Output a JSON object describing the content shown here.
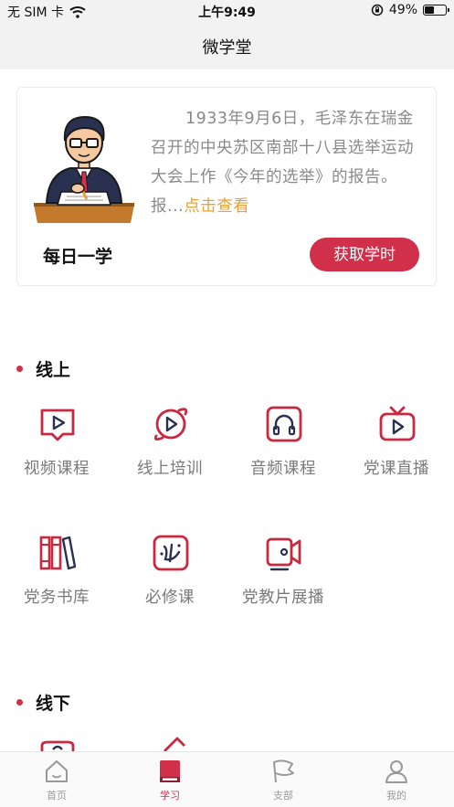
{
  "status_bar": {
    "carrier": "无 SIM 卡",
    "time": "上午9:49",
    "battery_percent": "49%",
    "battery_level": 0.49,
    "icons": [
      "wifi-icon",
      "orientation-lock-icon",
      "battery-icon"
    ]
  },
  "nav": {
    "title": "微学堂"
  },
  "daily_card": {
    "excerpt": "1933年9月6日，毛泽东在瑞金召开的中央苏区南部十八县选举运动大会上作《今年的选举》的报告。报...",
    "more_link": "点击查看",
    "label": "每日一学",
    "button": "获取学时",
    "illustration": "reading-official-illustration"
  },
  "online": {
    "title": "线上",
    "items": [
      {
        "label": "视频课程",
        "icon": "video-course-icon"
      },
      {
        "label": "线上培训",
        "icon": "online-training-icon"
      },
      {
        "label": "音频课程",
        "icon": "audio-course-icon"
      },
      {
        "label": "党课直播",
        "icon": "live-tv-icon"
      },
      {
        "label": "党务书库",
        "icon": "bookshelf-icon"
      },
      {
        "label": "必修课",
        "icon": "required-course-icon"
      },
      {
        "label": "党教片展播",
        "icon": "video-camera-icon"
      }
    ]
  },
  "offline": {
    "title": "线下"
  },
  "tabbar": {
    "items": [
      {
        "label": "首页",
        "icon": "home-icon"
      },
      {
        "label": "学习",
        "icon": "book-icon"
      },
      {
        "label": "支部",
        "icon": "flag-icon"
      },
      {
        "label": "我的",
        "icon": "user-icon"
      }
    ],
    "active_index": 1
  },
  "colors": {
    "accent": "#d0304a",
    "link": "#e6a23c",
    "bar_bg": "#f2f2f2"
  }
}
